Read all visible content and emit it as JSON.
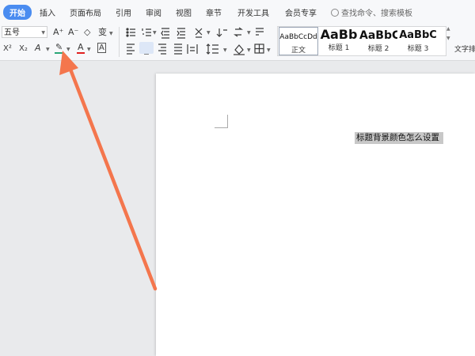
{
  "tabs": [
    {
      "label": "开始",
      "active": true
    },
    {
      "label": "插入"
    },
    {
      "label": "页面布局"
    },
    {
      "label": "引用"
    },
    {
      "label": "审阅"
    },
    {
      "label": "视图"
    },
    {
      "label": "章节"
    },
    {
      "label": "开发工具"
    },
    {
      "label": "会员专享"
    }
  ],
  "search": {
    "label": "查找命令、搜索模板"
  },
  "font": {
    "size_value": "五号"
  },
  "toolbar": {
    "superscript": "X²",
    "subscript": "X₂",
    "text_effect": "A",
    "highlight": "✎",
    "font_color": "A",
    "char_border": "A",
    "grow_font": "A⁺",
    "shrink_font": "A⁻",
    "clear_format": "◇",
    "phonetic": "变"
  },
  "styles": [
    {
      "preview": "AaBbCcDd",
      "name": "正文"
    },
    {
      "preview": "AaBb",
      "name": "标题 1"
    },
    {
      "preview": "AaBbC",
      "name": "标题 2"
    },
    {
      "preview": "AaBbC",
      "name": "标题 3"
    }
  ],
  "text_layout": "文字排",
  "document": {
    "selected_text": "标题背景颜色怎么设置"
  },
  "colors": {
    "accent": "#4a8cf0",
    "annotation_arrow": "#f4764d",
    "highlight_green": "#2aa676",
    "font_color_red": "#e02020"
  }
}
